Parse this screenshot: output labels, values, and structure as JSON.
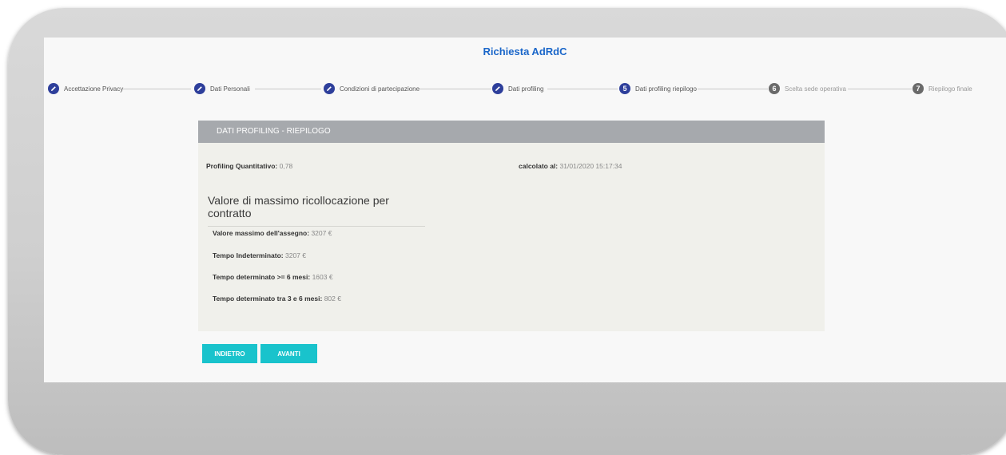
{
  "app": {
    "title": "Richiesta AdRdC"
  },
  "stepper": {
    "steps": [
      {
        "label": "Accettazione Privacy",
        "state": "done",
        "icon": "pencil-icon"
      },
      {
        "label": "Dati Personali",
        "state": "done",
        "icon": "pencil-icon"
      },
      {
        "label": "Condizioni di partecipazione",
        "state": "done",
        "icon": "pencil-icon"
      },
      {
        "label": "Dati profiling",
        "state": "done",
        "icon": "pencil-icon"
      },
      {
        "label": "Dati profiling riepilogo",
        "state": "active",
        "number": "5"
      },
      {
        "label": "Scelta sede operativa",
        "state": "todo",
        "number": "6"
      },
      {
        "label": "Riepilogo finale",
        "state": "todo",
        "number": "7"
      }
    ]
  },
  "panel": {
    "header": "DATI PROFILING - RIEPILOGO",
    "profiling": {
      "label": "Profiling Quantitativo:",
      "value": "0,78"
    },
    "calcolato": {
      "label": "calcolato al:",
      "value": "31/01/2020 15:17:34"
    },
    "section_title": "Valore di massimo ricollocazione per contratto",
    "rows": [
      {
        "label": "Valore massimo dell'assegno:",
        "value": "3207 €"
      },
      {
        "label": "Tempo Indeterminato:",
        "value": "3207 €"
      },
      {
        "label": "Tempo determinato >= 6 mesi:",
        "value": "1603 €"
      },
      {
        "label": "Tempo determinato tra 3 e 6 mesi:",
        "value": "802 €"
      }
    ]
  },
  "buttons": {
    "back": "INDIETRO",
    "next": "AVANTI"
  },
  "colors": {
    "accent": "#1a66c9",
    "step_done": "#2e3f9b",
    "step_todo": "#6a6a6a",
    "panel_header": "#a6a9ad",
    "button": "#19c3cc"
  }
}
